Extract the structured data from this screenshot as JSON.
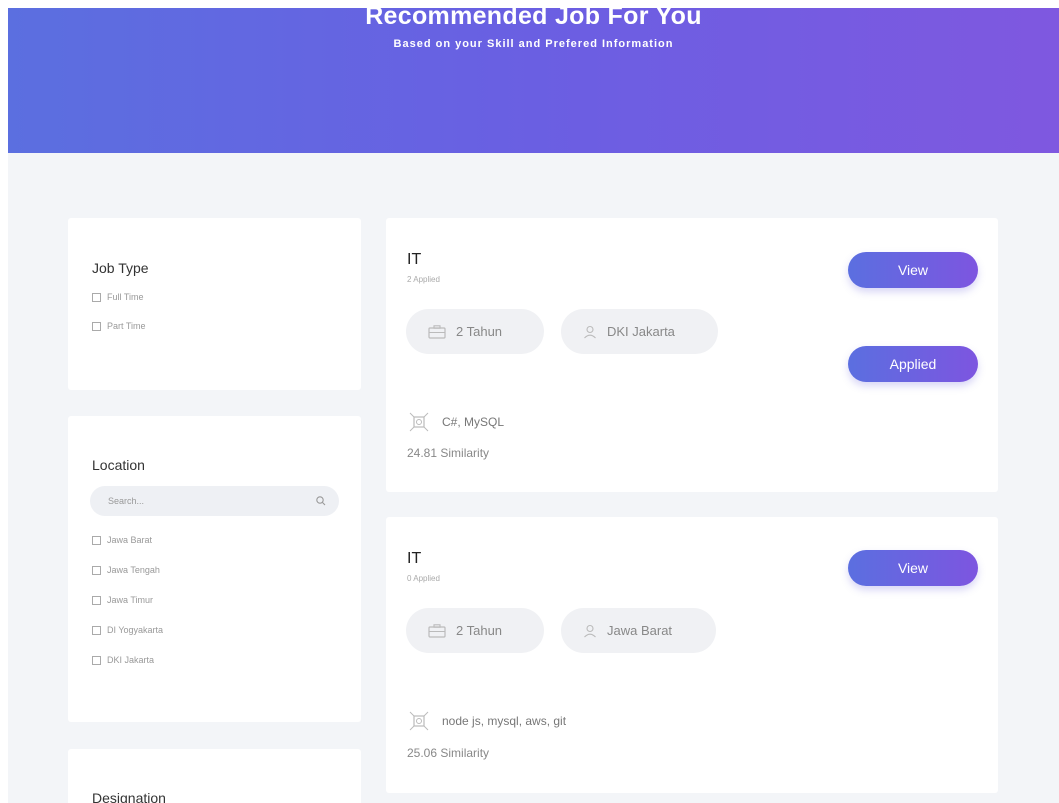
{
  "hero": {
    "title": "Recommended Job For You",
    "subtitle": "Based on your Skill and Prefered Information"
  },
  "filters": {
    "job_type": {
      "title": "Job Type",
      "options": [
        "Full Time",
        "Part Time"
      ]
    },
    "location": {
      "title": "Location",
      "search_placeholder": "Search...",
      "options": [
        "Jawa Barat",
        "Jawa Tengah",
        "Jawa Timur",
        "DI Yogyakarta",
        "DKI Jakarta"
      ]
    },
    "designation": {
      "title": "Designation"
    }
  },
  "jobs": [
    {
      "title": "IT",
      "applied_count": "2 Applied",
      "experience": "2 Tahun",
      "location": "DKI Jakarta",
      "skills": "C#, MySQL",
      "similarity": "24.81 Similarity",
      "view_label": "View",
      "applied_label": "Applied"
    },
    {
      "title": "IT",
      "applied_count": "0 Applied",
      "experience": "2 Tahun",
      "location": "Jawa Barat",
      "skills": "node js, mysql, aws, git",
      "similarity": "25.06 Similarity",
      "view_label": "View"
    }
  ],
  "colors": {
    "accent_start": "#5b6fe0",
    "accent_end": "#7d55e0",
    "background": "#f3f5f8"
  }
}
